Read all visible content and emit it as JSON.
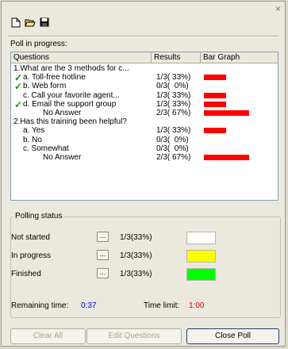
{
  "window": {
    "close_glyph": "×"
  },
  "toolbar": {
    "icons": [
      "new-document-icon",
      "open-folder-icon",
      "save-disk-icon"
    ]
  },
  "poll": {
    "label": "Poll in progress:",
    "headers": [
      "Questions",
      "Results",
      "Bar Graph"
    ],
    "rows": [
      {
        "text": "1.What are the 3 methods for c...",
        "result": "",
        "fraction": null,
        "check": false,
        "indent": 0
      },
      {
        "text": "a. Toll-free hotline",
        "result": "1/3( 33%)",
        "fraction": 0.33,
        "check": true,
        "indent": 1
      },
      {
        "text": "b. Web form",
        "result": "0/3(  0%)",
        "fraction": 0,
        "check": true,
        "indent": 1
      },
      {
        "text": "c. Call your favorite agent...",
        "result": "1/3( 33%)",
        "fraction": 0.33,
        "check": false,
        "indent": 1
      },
      {
        "text": "d. Email the support group",
        "result": "1/3( 33%)",
        "fraction": 0.33,
        "check": true,
        "indent": 1
      },
      {
        "text": "No Answer",
        "result": "2/3( 67%)",
        "fraction": 0.67,
        "check": false,
        "indent": 2
      },
      {
        "text": "2.Has this training been helpful?",
        "result": "",
        "fraction": null,
        "check": false,
        "indent": 0
      },
      {
        "text": "a. Yes",
        "result": "1/3( 33%)",
        "fraction": 0.33,
        "check": false,
        "indent": 1
      },
      {
        "text": "b. No",
        "result": "0/3(  0%)",
        "fraction": 0,
        "check": false,
        "indent": 1
      },
      {
        "text": "c. Somewhat",
        "result": "0/3(  0%)",
        "fraction": 0,
        "check": false,
        "indent": 1
      },
      {
        "text": "No Answer",
        "result": "2/3( 67%)",
        "fraction": 0.67,
        "check": false,
        "indent": 2
      }
    ]
  },
  "status": {
    "title": "Polling status",
    "items": [
      {
        "label": "Not started",
        "button": "...",
        "value": "1/3(33%)",
        "color": "#ffffff"
      },
      {
        "label": "In progress",
        "button": "...",
        "value": "1/3(33%)",
        "color": "#ffff00"
      },
      {
        "label": "Finished",
        "button": "...",
        "value": "1/3(33%)",
        "color": "#00ff00"
      }
    ],
    "remaining_label": "Remaining time:",
    "remaining_value": "0:37",
    "limit_label": "Time limit:",
    "limit_value": "1:00",
    "remaining_color": "#0000cc",
    "limit_color": "#cc0000"
  },
  "buttons": {
    "clear_all": "Clear All",
    "edit_questions": "Edit Questions",
    "close_poll": "Close Poll"
  },
  "colors": {
    "bar": "#ff0000",
    "check": "#1a8a1a"
  }
}
